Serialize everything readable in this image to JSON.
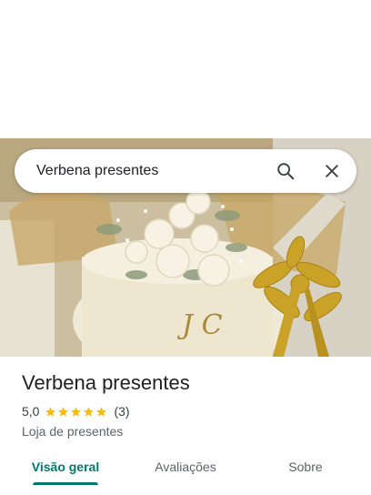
{
  "search": {
    "query": "Verbena presentes"
  },
  "place": {
    "name": "Verbena presentes",
    "rating": "5,0",
    "stars": 5,
    "review_count": "(3)",
    "category": "Loja de presentes"
  },
  "tabs": [
    "Visão geral",
    "Avaliações",
    "Sobre"
  ],
  "photo": {
    "monogram": "J C"
  },
  "colors": {
    "accent": "#00796b",
    "star": "#fbbc04",
    "ribbon": "#c9a227"
  }
}
